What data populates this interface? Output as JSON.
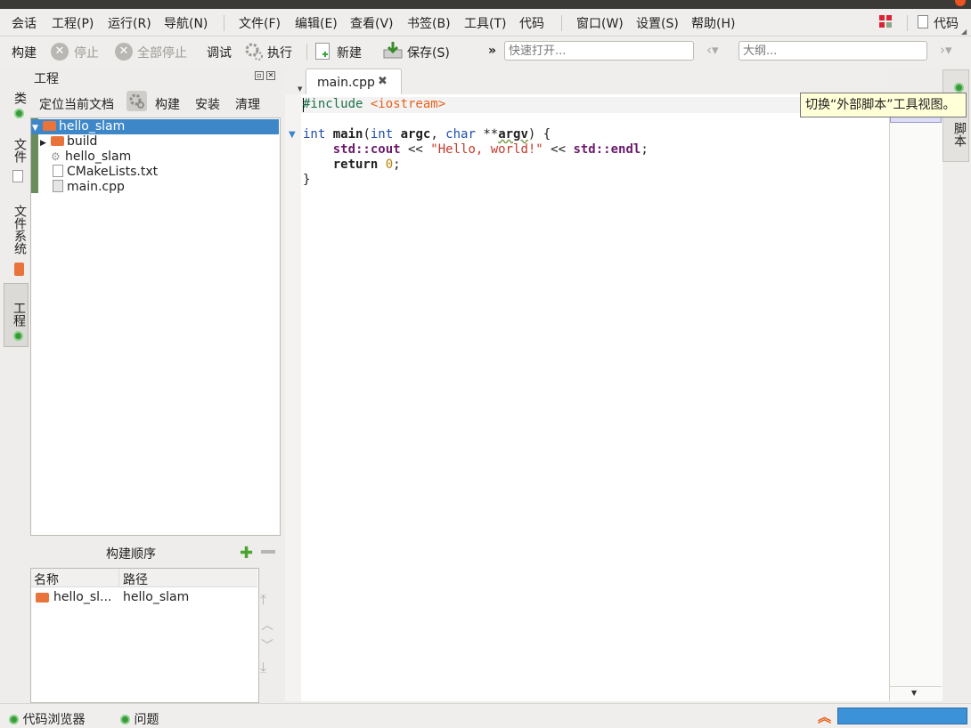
{
  "menubar": {
    "items": [
      "会话",
      "工程(P)",
      "运行(R)",
      "导航(N)",
      "文件(F)",
      "编辑(E)",
      "查看(V)",
      "书签(B)",
      "工具(T)",
      "代码",
      "窗口(W)",
      "设置(S)",
      "帮助(H)"
    ],
    "right_label": "代码"
  },
  "toolbar": {
    "build": "构建",
    "stop": "停止",
    "stop_all": "全部停止",
    "debug": "调试",
    "execute": "执行",
    "new": "新建",
    "save": "保存(S)",
    "more": "»",
    "quickopen_placeholder": "快速打开...",
    "outline_placeholder": "大纲..."
  },
  "left_tabs": [
    "类",
    "文件",
    "文件系统",
    "工程"
  ],
  "project_panel": {
    "title": "工程",
    "locate_current": "定位当前文档",
    "build": "构建",
    "install": "安装",
    "clean": "清理",
    "tree": [
      {
        "label": "hello_slam",
        "type": "folder",
        "selected": true
      },
      {
        "label": "build",
        "type": "folder"
      },
      {
        "label": "hello_slam",
        "type": "executable"
      },
      {
        "label": "CMakeLists.txt",
        "type": "file"
      },
      {
        "label": "main.cpp",
        "type": "file"
      }
    ]
  },
  "build_order": {
    "title": "构建顺序",
    "col_name": "名称",
    "col_path": "路径",
    "row_name": "hello_sl...",
    "row_path": "hello_slam"
  },
  "editor": {
    "tab_label": "main.cpp",
    "close_glyph": "✖",
    "code": {
      "l1_pp": "#include ",
      "l1_inc": "<iostream>",
      "l3_int": "int ",
      "l3_main": "main",
      "l3_open": "(",
      "l3_int2": "int ",
      "l3_argc": "argc",
      "l3_comma": ", ",
      "l3_char": "char ",
      "l3_argv_pre": "**",
      "l3_argv": "argv",
      "l3_close": ") {",
      "l4_indent": "    ",
      "l4_std1": "std::cout",
      "l4_op1": " << ",
      "l4_str": "\"Hello, world!\"",
      "l4_op2": " << ",
      "l4_std2": "std::endl",
      "l4_semi": ";",
      "l5_indent": "    ",
      "l5_return": "return ",
      "l5_num": "0",
      "l5_semi": ";",
      "l6": "}"
    }
  },
  "right_tab": "脚本",
  "tooltip": "切换“外部脚本”工具视图。",
  "statusbar": {
    "code_browser": "代码浏览器",
    "problems": "问题"
  },
  "colors": {
    "selection": "#3d87c9",
    "folder": "#e8743b",
    "keyword": "#1f4fa8",
    "string": "#c23a2a",
    "progress": "#3c92d8"
  }
}
